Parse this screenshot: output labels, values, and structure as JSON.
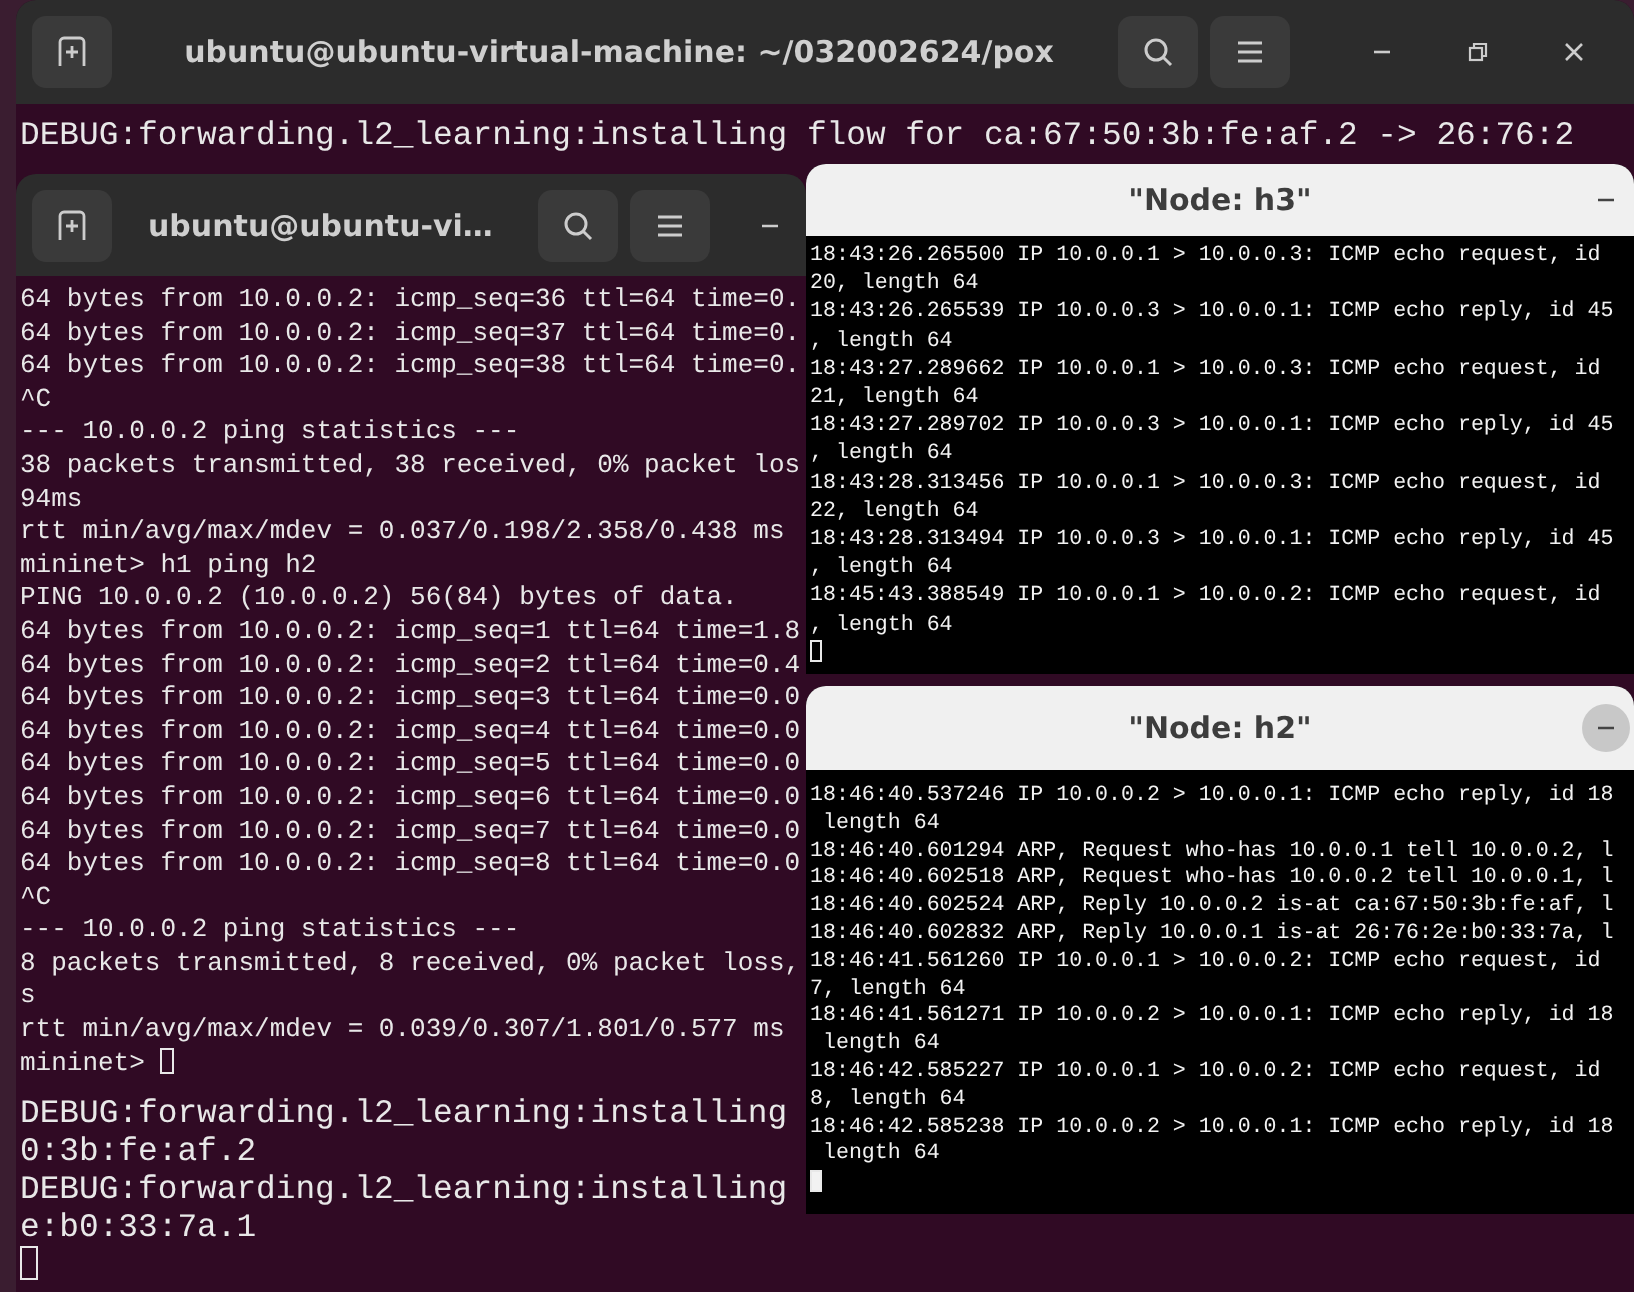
{
  "windows": [
    {
      "kind": "terminal",
      "title": "ubuntu@ubuntu-virtual-machine: ~/032002624/pox",
      "focused": false,
      "top_lines": [
        "DEBUG:forwarding.l2_learning:installing flow for ca:67:50:3b:fe:af.2 -> 26:76:2"
      ],
      "bottom_lines": [
        "DEBUG:forwarding.l2_learning:installing",
        "0:3b:fe:af.2",
        "DEBUG:forwarding.l2_learning:installing",
        "e:b0:33:7a.1"
      ]
    },
    {
      "kind": "terminal",
      "title": "ubuntu@ubuntu-vi…",
      "focused": false,
      "top_lines": [
        "64 bytes from 10.0.0.2: icmp_seq=36 ttl=64 time=0.",
        "64 bytes from 10.0.0.2: icmp_seq=37 ttl=64 time=0.",
        "64 bytes from 10.0.0.2: icmp_seq=38 ttl=64 time=0.",
        "^C",
        "--- 10.0.0.2 ping statistics ---",
        "38 packets transmitted, 38 received, 0% packet los",
        "94ms",
        "rtt min/avg/max/mdev = 0.037/0.198/2.358/0.438 ms",
        "mininet> h1 ping h2",
        "PING 10.0.0.2 (10.0.0.2) 56(84) bytes of data.",
        "64 bytes from 10.0.0.2: icmp_seq=1 ttl=64 time=1.8",
        "64 bytes from 10.0.0.2: icmp_seq=2 ttl=64 time=0.4",
        "64 bytes from 10.0.0.2: icmp_seq=3 ttl=64 time=0.0",
        "64 bytes from 10.0.0.2: icmp_seq=4 ttl=64 time=0.0",
        "64 bytes from 10.0.0.2: icmp_seq=5 ttl=64 time=0.0",
        "64 bytes from 10.0.0.2: icmp_seq=6 ttl=64 time=0.0",
        "64 bytes from 10.0.0.2: icmp_seq=7 ttl=64 time=0.0",
        "64 bytes from 10.0.0.2: icmp_seq=8 ttl=64 time=0.0",
        "^C",
        "--- 10.0.0.2 ping statistics ---",
        "8 packets transmitted, 8 received, 0% packet loss,",
        "s",
        "rtt min/avg/max/mdev = 0.039/0.307/1.801/0.577 ms",
        "mininet> "
      ],
      "cursor_inline": true
    },
    {
      "kind": "xterm",
      "title": "\"Node: h3\"",
      "focused": false,
      "top_lines": [
        "18:43:26.265500 IP 10.0.0.1 > 10.0.0.3: ICMP echo request, id",
        "20, length 64",
        "18:43:26.265539 IP 10.0.0.3 > 10.0.0.1: ICMP echo reply, id 45",
        ", length 64",
        "18:43:27.289662 IP 10.0.0.1 > 10.0.0.3: ICMP echo request, id",
        "21, length 64",
        "18:43:27.289702 IP 10.0.0.3 > 10.0.0.1: ICMP echo reply, id 45",
        ", length 64",
        "18:43:28.313456 IP 10.0.0.1 > 10.0.0.3: ICMP echo request, id",
        "22, length 64",
        "18:43:28.313494 IP 10.0.0.3 > 10.0.0.1: ICMP echo reply, id 45",
        ", length 64",
        "18:45:43.388549 IP 10.0.0.1 > 10.0.0.2: ICMP echo request, id",
        ", length 64"
      ]
    },
    {
      "kind": "xterm",
      "title": "\"Node: h2\"",
      "focused": true,
      "top_lines": [
        "18:46:40.537246 IP 10.0.0.2 > 10.0.0.1: ICMP echo reply, id 18",
        " length 64",
        "18:46:40.601294 ARP, Request who-has 10.0.0.1 tell 10.0.0.2, l",
        "18:46:40.602518 ARP, Request who-has 10.0.0.2 tell 10.0.0.1, l",
        "18:46:40.602524 ARP, Reply 10.0.0.2 is-at ca:67:50:3b:fe:af, l",
        "18:46:40.602832 ARP, Reply 10.0.0.1 is-at 26:76:2e:b0:33:7a, l",
        "18:46:41.561260 IP 10.0.0.1 > 10.0.0.2: ICMP echo request, id",
        "7, length 64",
        "18:46:41.561271 IP 10.0.0.2 > 10.0.0.1: ICMP echo reply, id 18",
        " length 64",
        "18:46:42.585227 IP 10.0.0.1 > 10.0.0.2: ICMP echo request, id",
        "8, length 64",
        "18:46:42.585238 IP 10.0.0.2 > 10.0.0.1: ICMP echo reply, id 18",
        " length 64"
      ]
    }
  ]
}
